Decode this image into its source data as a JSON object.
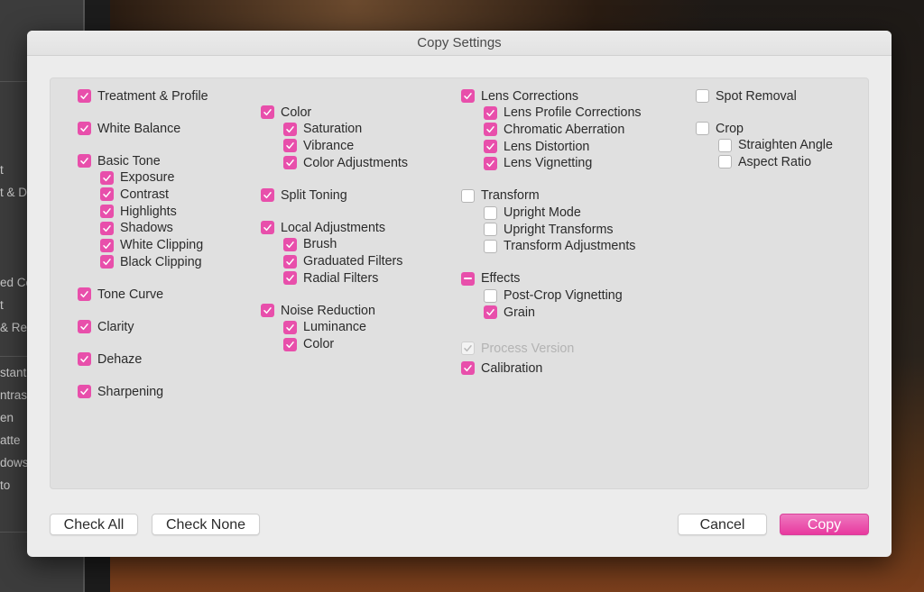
{
  "background_panel_items": [
    "t",
    "t & D",
    "ed Co",
    "t",
    "& Re",
    "stant",
    "ntrast",
    "en",
    "atte",
    "dows",
    "to"
  ],
  "dialog": {
    "title": "Copy Settings",
    "accent_color": "#e84fab",
    "columns": [
      [
        {
          "label": "Treatment & Profile",
          "state": "checked"
        },
        {
          "label": "White Balance",
          "state": "checked"
        },
        {
          "label": "Basic Tone",
          "state": "checked",
          "children": [
            {
              "label": "Exposure",
              "state": "checked"
            },
            {
              "label": "Contrast",
              "state": "checked"
            },
            {
              "label": "Highlights",
              "state": "checked"
            },
            {
              "label": "Shadows",
              "state": "checked"
            },
            {
              "label": "White Clipping",
              "state": "checked"
            },
            {
              "label": "Black Clipping",
              "state": "checked"
            }
          ]
        },
        {
          "label": "Tone Curve",
          "state": "checked"
        },
        {
          "label": "Clarity",
          "state": "checked"
        },
        {
          "label": "Dehaze",
          "state": "checked"
        },
        {
          "label": "Sharpening",
          "state": "checked"
        }
      ],
      [
        {
          "label": "Color",
          "state": "checked",
          "children": [
            {
              "label": "Saturation",
              "state": "checked"
            },
            {
              "label": "Vibrance",
              "state": "checked"
            },
            {
              "label": "Color Adjustments",
              "state": "checked"
            }
          ]
        },
        {
          "label": "Split Toning",
          "state": "checked"
        },
        {
          "label": "Local Adjustments",
          "state": "checked",
          "children": [
            {
              "label": "Brush",
              "state": "checked"
            },
            {
              "label": "Graduated Filters",
              "state": "checked"
            },
            {
              "label": "Radial Filters",
              "state": "checked"
            }
          ]
        },
        {
          "label": "Noise Reduction",
          "state": "checked",
          "children": [
            {
              "label": "Luminance",
              "state": "checked"
            },
            {
              "label": "Color",
              "state": "checked"
            }
          ]
        }
      ],
      [
        {
          "label": "Lens Corrections",
          "state": "checked",
          "children": [
            {
              "label": "Lens Profile Corrections",
              "state": "checked"
            },
            {
              "label": "Chromatic Aberration",
              "state": "checked"
            },
            {
              "label": "Lens Distortion",
              "state": "checked"
            },
            {
              "label": "Lens Vignetting",
              "state": "checked"
            }
          ]
        },
        {
          "label": "Transform",
          "state": "unchecked",
          "children": [
            {
              "label": "Upright Mode",
              "state": "unchecked"
            },
            {
              "label": "Upright Transforms",
              "state": "unchecked"
            },
            {
              "label": "Transform Adjustments",
              "state": "unchecked"
            }
          ]
        },
        {
          "label": "Effects",
          "state": "mixed",
          "children": [
            {
              "label": "Post-Crop Vignetting",
              "state": "unchecked"
            },
            {
              "label": "Grain",
              "state": "checked"
            }
          ]
        },
        {
          "label": "Process Version",
          "state": "disabled"
        },
        {
          "label": "Calibration",
          "state": "checked"
        }
      ],
      [
        {
          "label": "Spot Removal",
          "state": "unchecked"
        },
        {
          "label": "Crop",
          "state": "unchecked",
          "children": [
            {
              "label": "Straighten Angle",
              "state": "unchecked"
            },
            {
              "label": "Aspect Ratio",
              "state": "unchecked"
            }
          ]
        }
      ]
    ],
    "buttons": {
      "check_all": "Check All",
      "check_none": "Check None",
      "cancel": "Cancel",
      "copy": "Copy"
    }
  }
}
